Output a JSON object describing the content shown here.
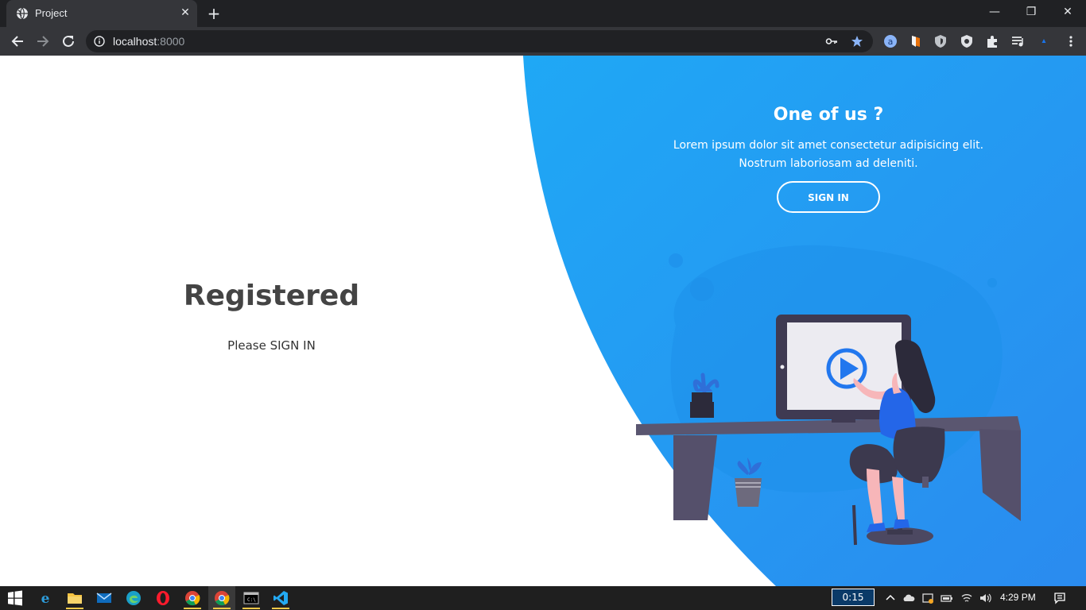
{
  "browser": {
    "tab_title": "Project",
    "tab_close": "✕",
    "new_tab": "+",
    "url_host": "localhost",
    "url_port": ":8000",
    "window_controls": {
      "minimize": "—",
      "restore": "❐",
      "close": "✕"
    }
  },
  "page": {
    "left": {
      "title": "Registered",
      "text": "Please SIGN IN"
    },
    "right": {
      "title": "One of us ?",
      "text_line1": "Lorem ipsum dolor sit amet consectetur adipisicing elit.",
      "text_line2": "Nostrum laboriosam ad deleniti.",
      "button_label": "SIGN IN"
    },
    "colors": {
      "accent_blue": "#1da1f2",
      "gradient_end": "#2b8ff0"
    }
  },
  "taskbar": {
    "timer": "0:15",
    "clock": "4:29 PM",
    "apps": [
      "start-icon",
      "edge-legacy-icon",
      "file-explorer-icon",
      "mail-icon",
      "edge-icon",
      "opera-icon",
      "chrome-icon",
      "chrome-icon",
      "terminal-icon",
      "vscode-icon"
    ]
  }
}
